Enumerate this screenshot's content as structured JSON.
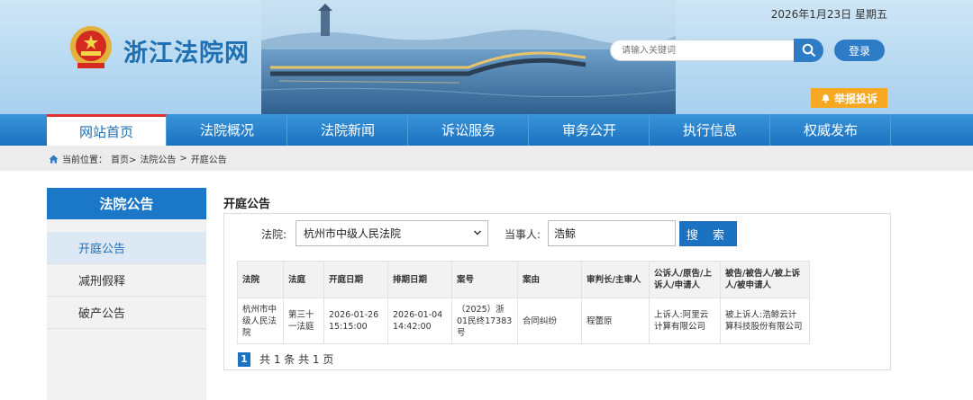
{
  "header": {
    "date": "2026年1月23日 星期五",
    "site_title": "浙江法院网",
    "search_placeholder": "请输入关键词",
    "login_label": "登录",
    "report_label": "举报投诉"
  },
  "nav": [
    "网站首页",
    "法院概况",
    "法院新闻",
    "诉讼服务",
    "审务公开",
    "执行信息",
    "权威发布"
  ],
  "breadcrumb": {
    "prefix": "当前位置：",
    "home": "首页>",
    "section": "法院公告",
    "sep": ">",
    "current": "开庭公告"
  },
  "sidebar": {
    "title": "法院公告",
    "items": [
      "开庭公告",
      "减刑假释",
      "破产公告"
    ]
  },
  "main": {
    "title": "开庭公告",
    "court_label": "法院:",
    "court_value": "杭州市中级人民法院",
    "party_label": "当事人:",
    "party_value": "浩鲸",
    "search_label": "搜 索"
  },
  "table": {
    "headers": [
      "法院",
      "法庭",
      "开庭日期",
      "排期日期",
      "案号",
      "案由",
      "审判长/主审人",
      "公诉人/原告/上诉人/申请人",
      "被告/被告人/被上诉人/被申请人"
    ],
    "rows": [
      [
        "杭州市中级人民法院",
        "第三十一法庭",
        "2026-01-26 15:15:00",
        "2026-01-04 14:42:00",
        "（2025）浙01民终17383号",
        "合同纠纷",
        "程蕾原",
        "上诉人:阿里云计算有限公司",
        "被上诉人:浩鲸云计算科技股份有限公司"
      ]
    ]
  },
  "pager": {
    "page": "1",
    "summary": "共 1 条 共 1 页"
  }
}
